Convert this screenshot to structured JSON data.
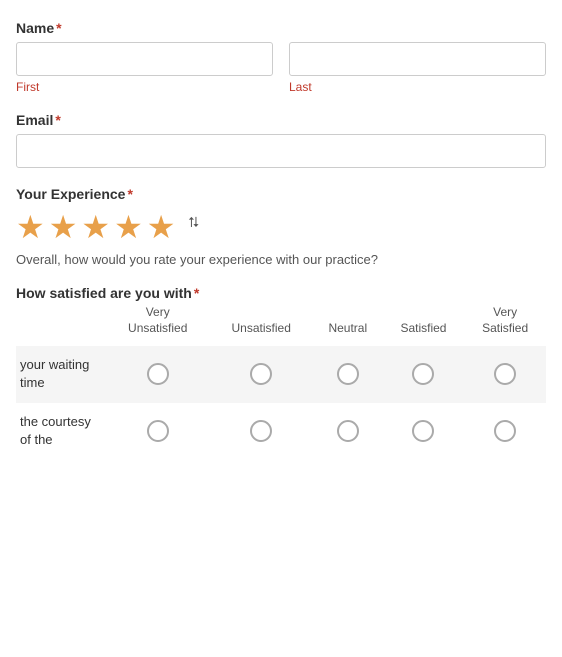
{
  "form": {
    "name_label": "Name",
    "name_required": "*",
    "first_label": "First",
    "last_label": "Last",
    "email_label": "Email",
    "email_required": "*",
    "experience_label": "Your Experience",
    "experience_required": "*",
    "experience_desc": "Overall, how would you rate your experience with our practice?",
    "satisfaction_label": "How satisfied are you with",
    "satisfaction_required": "*",
    "stars": [
      {
        "filled": true
      },
      {
        "filled": true
      },
      {
        "filled": true
      },
      {
        "filled": true
      },
      {
        "filled": true
      }
    ],
    "satisfaction_headers": [
      "",
      "Very Unsatisfied",
      "Unsatisfied",
      "Neutral",
      "Satisfied",
      "Very Satisfied"
    ],
    "satisfaction_rows": [
      {
        "label": "your waiting time",
        "shaded": true
      },
      {
        "label": "the courtesy of the",
        "shaded": false
      }
    ]
  }
}
